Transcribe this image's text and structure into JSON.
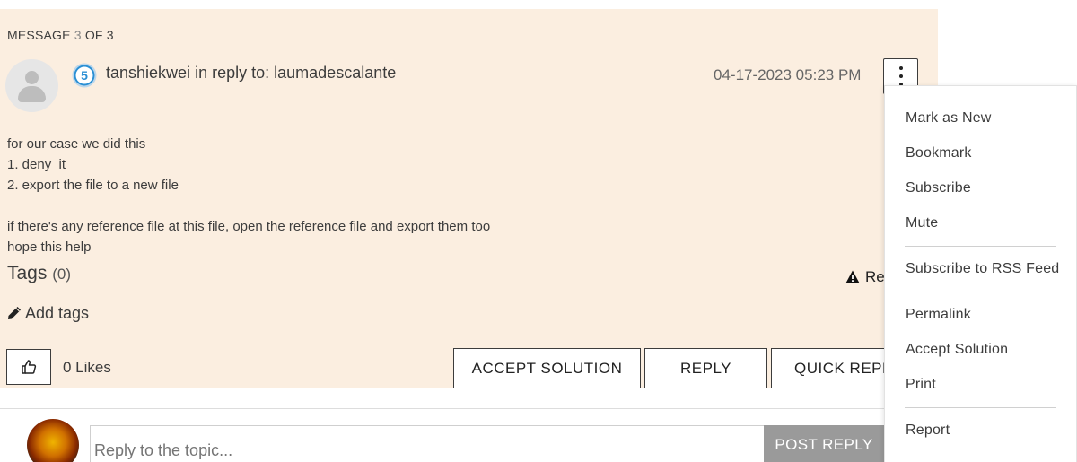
{
  "message": {
    "counter": {
      "prefix": "MESSAGE",
      "current": "3",
      "of": "OF",
      "total": "3"
    },
    "author": "tanshiekwei",
    "in_reply_to_label": "in reply to:",
    "reply_to_user": "laumadescalante",
    "rank_badge": "5",
    "timestamp": "04-17-2023 05:23 PM",
    "body_lines": [
      "for our case we did this",
      "1. deny  it",
      "2. export the file to a new file",
      "",
      "if there's any reference file at this file, open the reference file and export them too",
      "hope this help"
    ],
    "tags_label": "Tags",
    "tags_count": "(0)",
    "report_label": "Re",
    "add_tags_label": "Add tags",
    "likes_label": "0 Likes",
    "accept_solution_label": "ACCEPT SOLUTION",
    "reply_label": "REPLY",
    "quick_reply_label": "QUICK REPLY"
  },
  "reply_box": {
    "placeholder": "Reply to the topic...",
    "post_label": "POST REPLY"
  },
  "menu": {
    "items": [
      "Mark as New",
      "Bookmark",
      "Subscribe",
      "Mute",
      "Subscribe to RSS Feed",
      "Permalink",
      "Accept Solution",
      "Print",
      "Report"
    ]
  },
  "colors": {
    "panel_bg": "#fbeee0",
    "badge_blue": "#2a8fd4",
    "post_button_bg": "#9a9a9a"
  }
}
